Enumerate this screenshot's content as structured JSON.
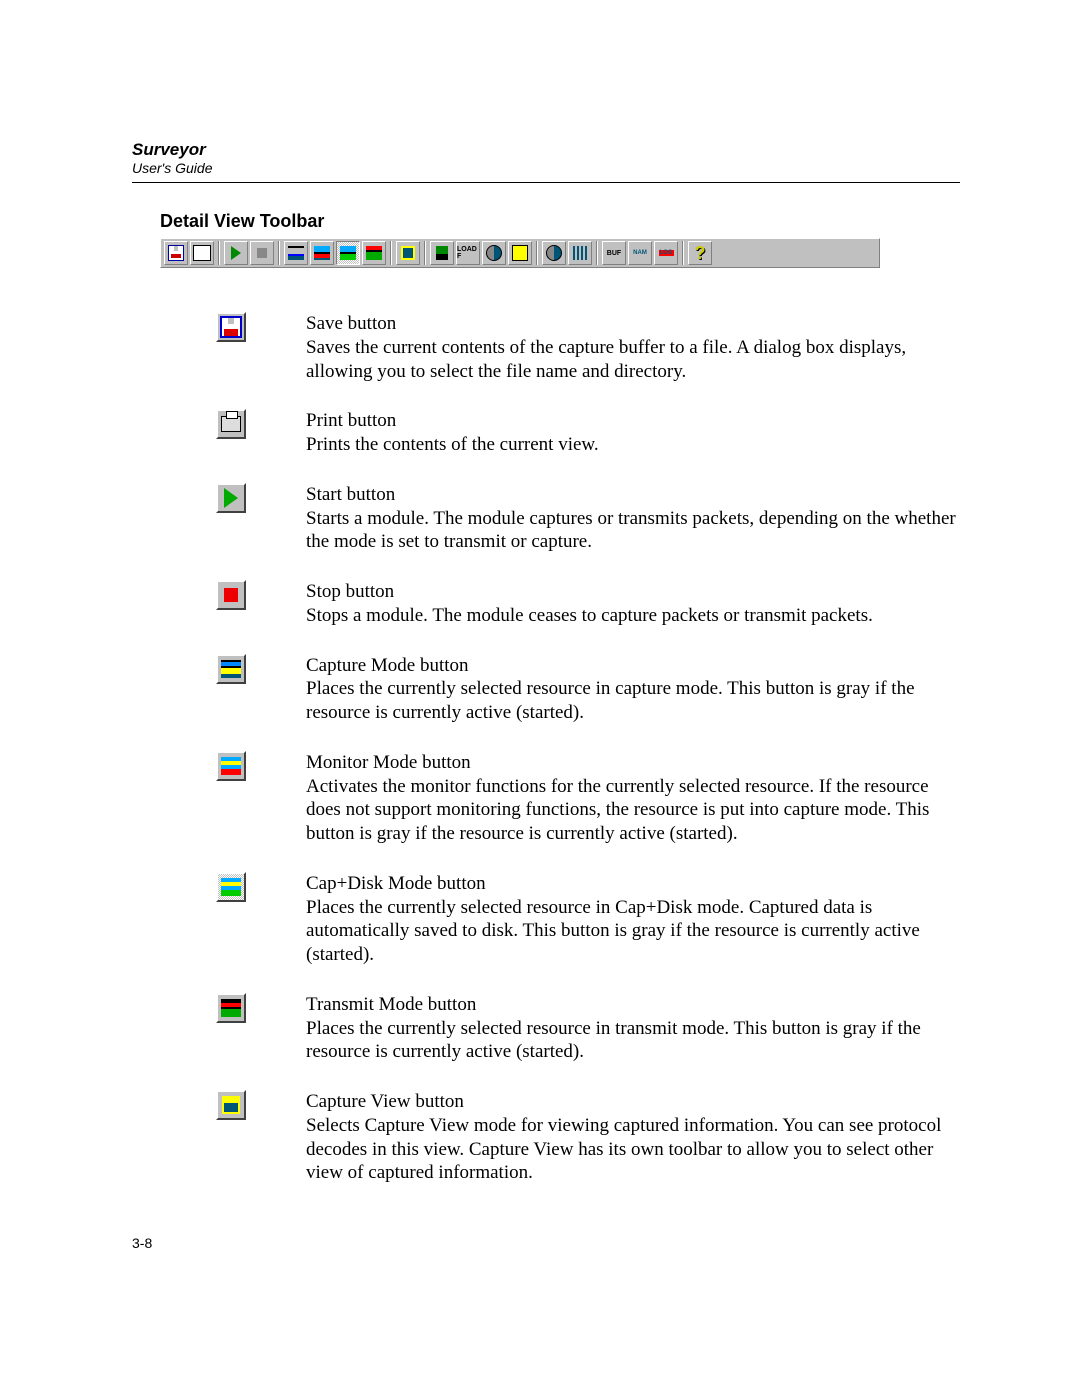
{
  "header": {
    "title": "Surveyor",
    "subtitle": "User's Guide"
  },
  "section_heading": "Detail View Toolbar",
  "page_number": "3-8",
  "toolbar": [
    {
      "name": "save",
      "glyph": "g-disk",
      "sep_after": false
    },
    {
      "name": "print",
      "glyph": "g-print",
      "sep_after": true
    },
    {
      "name": "start",
      "glyph": "g-play",
      "sep_after": false
    },
    {
      "name": "stop",
      "glyph": "g-stopsq",
      "sep_after": true
    },
    {
      "name": "capture-mode",
      "glyph": "g-stripes",
      "sep_after": false
    },
    {
      "name": "monitor-mode",
      "glyph": "g-strM",
      "sep_after": false
    },
    {
      "name": "capdisk-mode",
      "glyph": "g-strG",
      "pressed": true,
      "sep_after": false
    },
    {
      "name": "transmit-mode",
      "glyph": "g-strT",
      "sep_after": true
    },
    {
      "name": "capture-view",
      "glyph": "g-list",
      "sep_after": true
    },
    {
      "name": "flag",
      "glyph": "g-flag",
      "sep_after": false
    },
    {
      "name": "load",
      "text": "LOAD F",
      "cls": "g-txtLD",
      "sep_after": false
    },
    {
      "name": "gauge",
      "glyph": "g-tool",
      "sep_after": false
    },
    {
      "name": "note",
      "glyph": "g-note",
      "sep_after": true
    },
    {
      "name": "sweep",
      "glyph": "g-tool",
      "sep_after": false
    },
    {
      "name": "bars",
      "glyph": "g-bars",
      "sep_after": true
    },
    {
      "name": "buf",
      "text": "BUF",
      "cls": "g-txtBUF",
      "sep_after": false
    },
    {
      "name": "nam",
      "text": "NAM",
      "cls": "g-txtNAM",
      "sep_after": false
    },
    {
      "name": "log",
      "text": "LOG",
      "cls": "g-txtLOG",
      "sep_after": true
    },
    {
      "name": "help",
      "text": "?",
      "cls": "g-q",
      "sep_after": false
    }
  ],
  "items": [
    {
      "icon": "big-disk",
      "pressed": false,
      "title": "Save button",
      "desc": "Saves the current contents of the capture buffer to a file. A dialog box displays, allowing you to select the file name and directory."
    },
    {
      "icon": "big-print",
      "pressed": false,
      "title": "Print button",
      "desc": "Prints the contents of the current view."
    },
    {
      "icon": "big-play",
      "pressed": false,
      "title": "Start button",
      "desc": "Starts a module. The module captures or transmits packets, depending on the whether the mode is set to transmit or capture."
    },
    {
      "icon": "big-stopsq",
      "pressed": false,
      "title": "Stop button",
      "desc": "Stops a module. The module ceases to capture packets or transmit packets."
    },
    {
      "icon": "big-stripes",
      "pressed": false,
      "title": "Capture Mode button",
      "desc": "Places the currently selected resource in capture mode. This button is gray if the resource is currently active (started)."
    },
    {
      "icon": "big-strM",
      "pressed": false,
      "title": "Monitor Mode button",
      "desc": "Activates the monitor functions for the currently selected resource. If the resource does not support monitoring functions, the resource is put into capture mode. This button is gray if the resource is currently active (started)."
    },
    {
      "icon": "big-strG",
      "pressed": true,
      "title": "Cap+Disk Mode button",
      "desc": "Places the currently selected resource in Cap+Disk mode. Captured data is automatically saved to disk. This button is gray if the resource is currently active (started)."
    },
    {
      "icon": "big-strT",
      "pressed": false,
      "title": "Transmit Mode button",
      "desc": "Places the currently selected resource in transmit mode. This button is gray if the resource is currently active (started)."
    },
    {
      "icon": "big-list",
      "pressed": false,
      "title": "Capture View button",
      "desc": "Selects Capture View mode for viewing captured information. You can see protocol decodes in this view. Capture View has its own toolbar to allow you to select other view of captured information."
    }
  ]
}
